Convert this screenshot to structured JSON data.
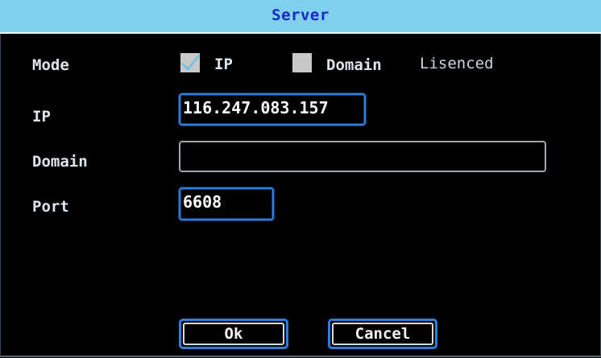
{
  "dialog": {
    "title": "Server"
  },
  "mode": {
    "label": "Mode",
    "options": [
      {
        "label": "IP",
        "checked": true
      },
      {
        "label": "Domain",
        "checked": false
      }
    ],
    "status": "Lisenced"
  },
  "ip": {
    "label": "IP",
    "value": "116.247.083.157"
  },
  "domain": {
    "label": "Domain",
    "value": ""
  },
  "port": {
    "label": "Port",
    "value": "6608"
  },
  "buttons": {
    "ok_label": "Ok",
    "cancel_label": "Cancel"
  },
  "colors": {
    "title_bar": "#7fcfef",
    "title_text": "#1a24c8",
    "focus_border": "#2f7fd8",
    "background": "#000000"
  }
}
